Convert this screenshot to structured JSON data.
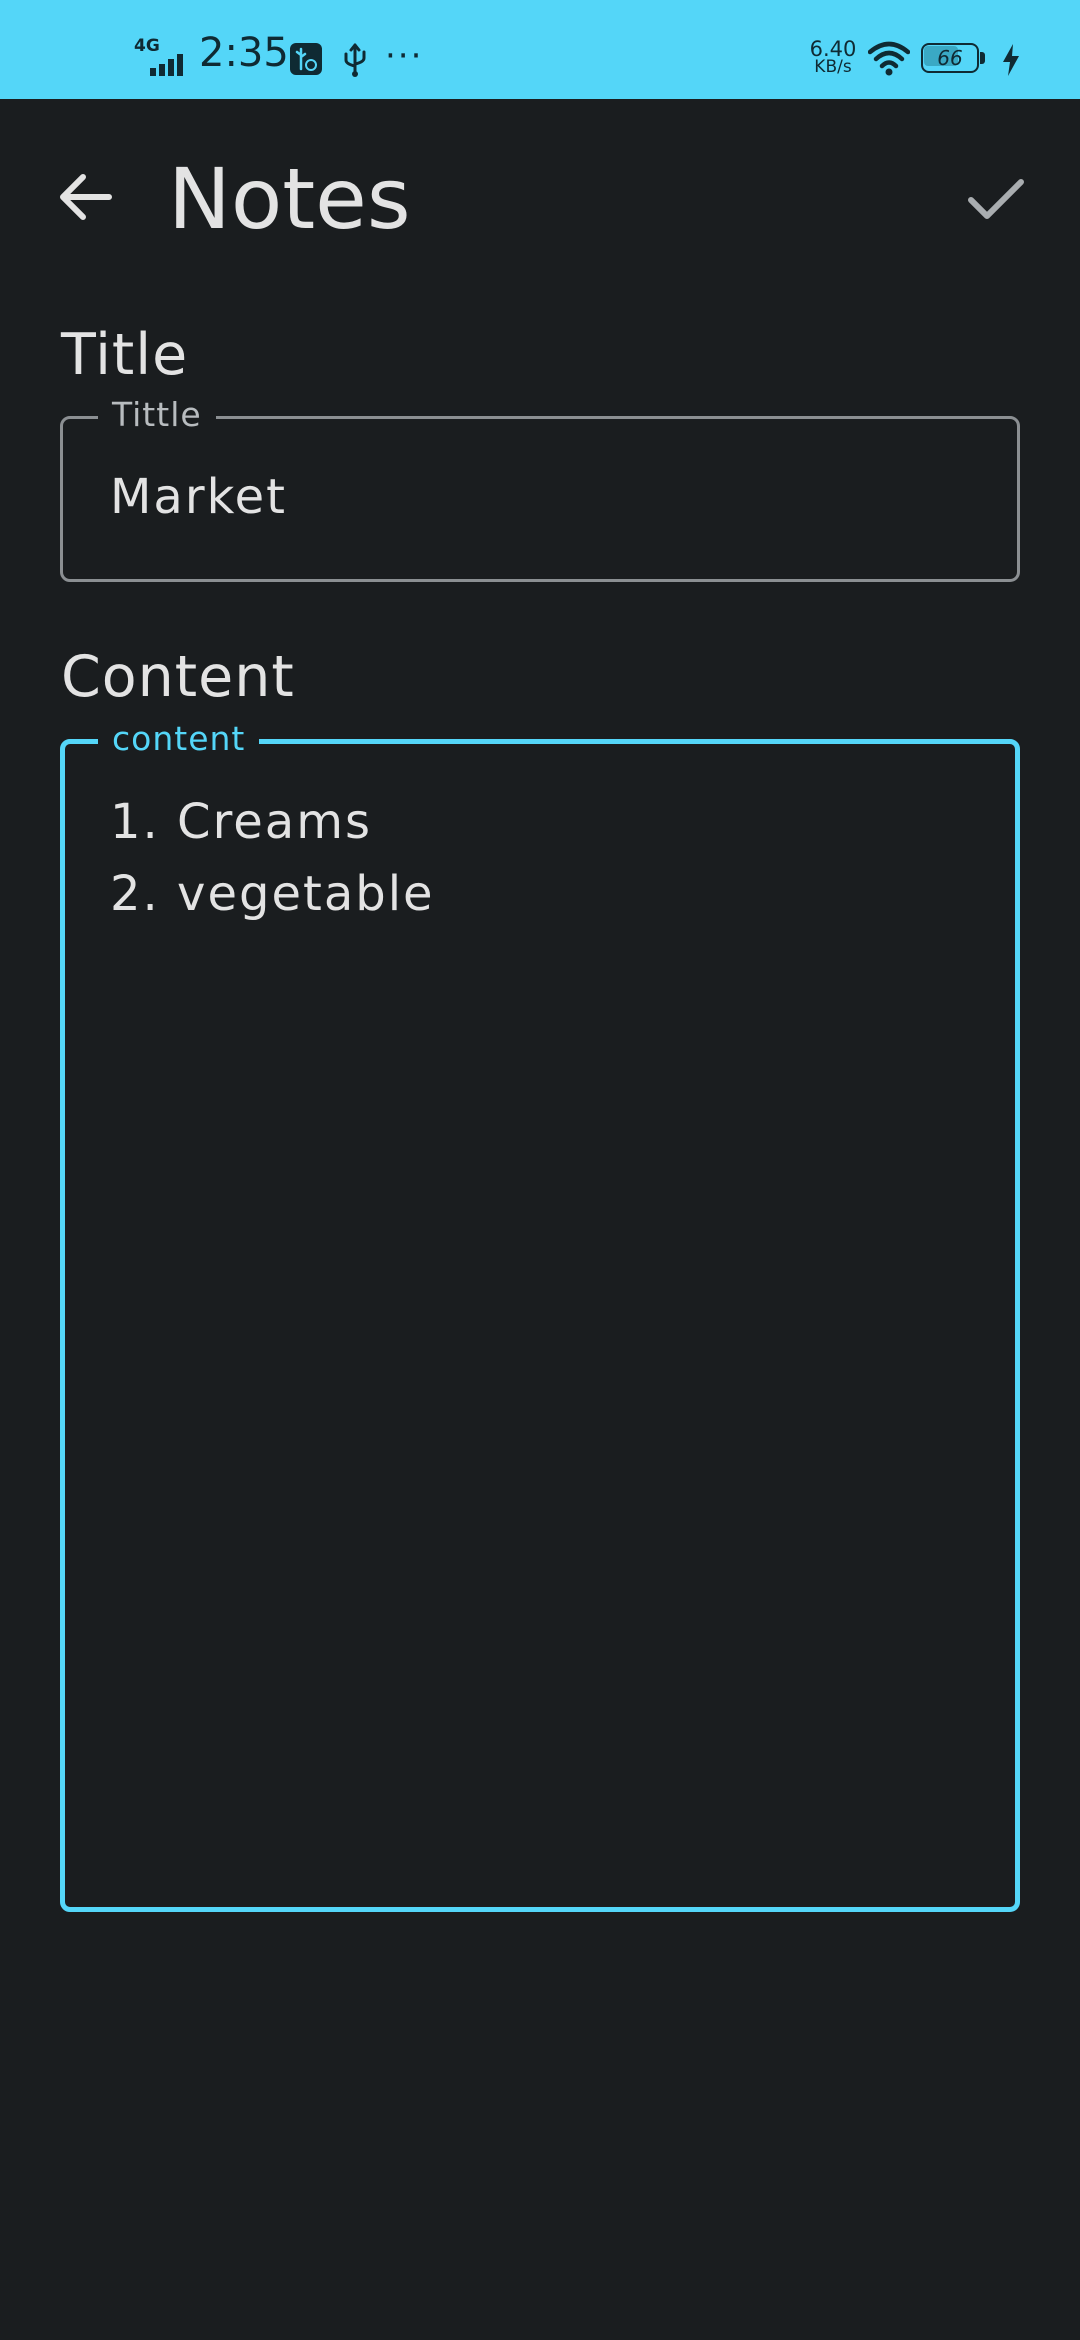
{
  "status_bar": {
    "network": "4G",
    "time": "2:35",
    "more": "···",
    "speed_value": "6.40",
    "speed_unit": "KB/s",
    "battery_level": "66",
    "battery_fraction": 0.66,
    "background_color": "#54d6f8",
    "icons": [
      "signal-icon",
      "usb-debugging-icon",
      "usb-icon",
      "wifi-icon",
      "battery-icon",
      "charging-icon"
    ]
  },
  "app_bar": {
    "title": "Notes",
    "back_icon": "arrow-left-icon",
    "save_icon": "check-icon"
  },
  "form": {
    "title_section": {
      "heading": "Title",
      "field_label": "Tittle",
      "value": "Market"
    },
    "content_section": {
      "heading": "Content",
      "field_label": "content",
      "lines": [
        "1. Creams",
        "2. vegetable"
      ]
    },
    "colors": {
      "background": "#1a1d1f",
      "accent": "#54d6f8",
      "text": "#e3e3e3",
      "outline": "#8b8f92"
    }
  }
}
